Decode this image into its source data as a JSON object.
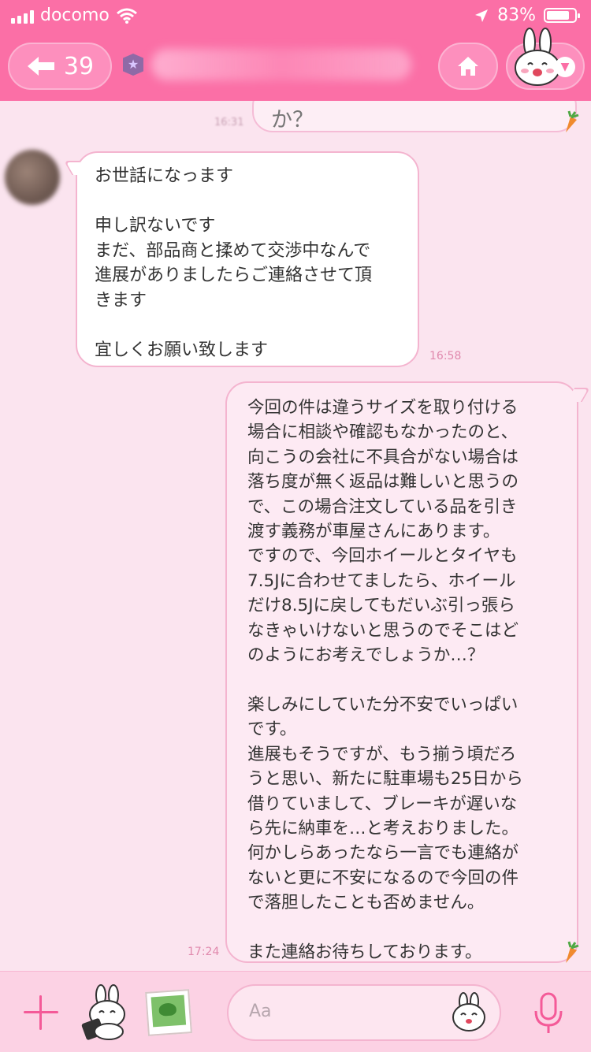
{
  "status_bar": {
    "carrier": "docomo",
    "battery_percent": "83%",
    "battery_level": 0.83
  },
  "header": {
    "back_count": "39",
    "contact_name": ""
  },
  "chat": {
    "previous_message_fragment": "か？",
    "previous_time": "16:31",
    "messages": [
      {
        "direction": "incoming",
        "text": "お世話になっます\n\n申し訳ないです\nまだ、部品商と揉めて交渉中なんで\n進展がありましたらご連絡させて頂\nきます\n\n宜しくお願い致します",
        "time": "16:58"
      },
      {
        "direction": "outgoing",
        "text": "今回の件は違うサイズを取り付ける\n場合に相談や確認もなかったのと、\n向こうの会社に不具合がない場合は\n落ち度が無く返品は難しいと思うの\nで、この場合注文している品を引き\n渡す義務が車屋さんにあります。\nですので、今回ホイールとタイヤも\n7.5Jに合わせてましたら、ホイール\nだけ8.5Jに戻してもだいぶ引っ張ら\nなきゃいけないと思うのでそこはど\nのようにお考えでしょうか…？\n\n楽しみにしていた分不安でいっぱい\nです。\n進展もそうですが、もう揃う頃だろ\nうと思い、新たに駐車場も25日から\n借りていまして、ブレーキが遅いな\nら先に納車を…と考えおりました。\n何かしらあったなら一言でも連絡が\nないと更に不安になるので今回の件\nで落胆したことも否めません。\n\nまた連絡お待ちしております。",
        "time": "17:24"
      }
    ]
  },
  "input_bar": {
    "placeholder": "Aa"
  },
  "colors": {
    "header_pink": "#fb6fa6",
    "background": "#fbe4ef",
    "bubble_border": "#f4b4cf",
    "accent": "#f45a98"
  },
  "icons": [
    "signal-icon",
    "wifi-icon",
    "location-icon",
    "battery-icon",
    "back-arrow-icon",
    "star-badge-icon",
    "home-icon",
    "bunny-icon",
    "chevron-down-icon",
    "carrot-icon",
    "plus-icon",
    "sticker-icon",
    "photo-icon",
    "emoji-icon",
    "mic-icon"
  ]
}
